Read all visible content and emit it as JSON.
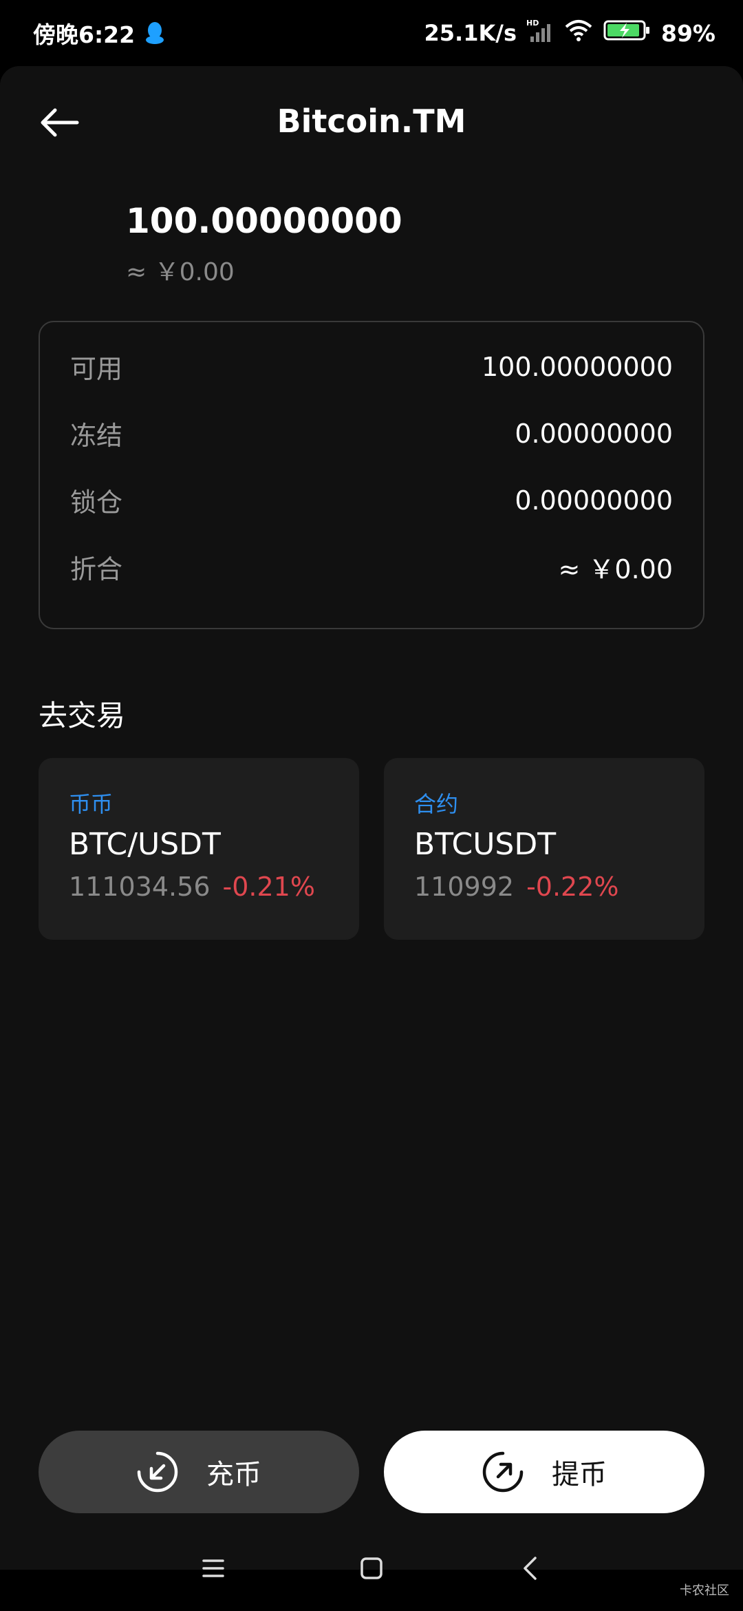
{
  "status_bar": {
    "time": "傍晚6:22",
    "net_speed": "25.1K/s",
    "battery": "89%",
    "icons": [
      "qq-icon",
      "signal-icon",
      "wifi-icon",
      "battery-charging-icon"
    ]
  },
  "header": {
    "title": "Bitcoin.TM",
    "back_icon": "arrow-left-icon"
  },
  "balance": {
    "amount": "100.00000000",
    "fiat": "≈ ￥0.00"
  },
  "details": [
    {
      "label": "可用",
      "value": "100.00000000"
    },
    {
      "label": "冻结",
      "value": "0.00000000"
    },
    {
      "label": "锁仓",
      "value": "0.00000000"
    },
    {
      "label": "折合",
      "value": "≈ ￥0.00"
    }
  ],
  "trade_section": {
    "title": "去交易",
    "cards": [
      {
        "type": "币币",
        "pair": "BTC/USDT",
        "price": "111034.56",
        "change": "-0.21%"
      },
      {
        "type": "合约",
        "pair": "BTCUSDT",
        "price": "110992",
        "change": "-0.22%"
      }
    ]
  },
  "actions": {
    "deposit_label": "充币",
    "withdraw_label": "提币"
  },
  "nav_bar": {
    "icons": [
      "menu-icon",
      "home-square-icon",
      "back-chevron-icon"
    ]
  },
  "watermark": "卡农社区",
  "colors": {
    "background": "#111111",
    "card": "#1e1e1e",
    "accent_blue": "#2e8ff0",
    "negative_red": "#e0474f",
    "muted": "#8a8a8a"
  }
}
